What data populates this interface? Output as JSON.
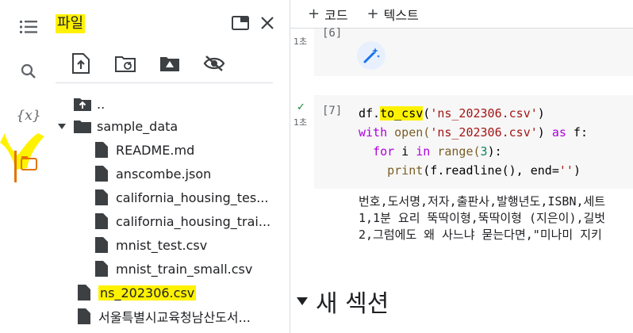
{
  "panel": {
    "title": "파일",
    "highlight_color": "#fff200"
  },
  "tree": [
    {
      "label": "..",
      "type": "folder-up"
    },
    {
      "label": "sample_data",
      "type": "folder"
    },
    {
      "label": "README.md",
      "type": "file"
    },
    {
      "label": "anscombe.json",
      "type": "file"
    },
    {
      "label": "california_housing_tes...",
      "type": "file"
    },
    {
      "label": "california_housing_trai...",
      "type": "file"
    },
    {
      "label": "mnist_test.csv",
      "type": "file"
    },
    {
      "label": "mnist_train_small.csv",
      "type": "file"
    },
    {
      "label": "ns_202306.csv",
      "type": "file"
    },
    {
      "label": "서울특별시교육청남산도서...",
      "type": "file"
    }
  ],
  "notebook": {
    "add_code": "코드",
    "add_text": "텍스트",
    "cell6": {
      "bracket": "[6]",
      "time": "1초"
    },
    "cell7": {
      "bracket": "[7]",
      "time": "1초",
      "line1_a": "df.",
      "line1_b": "to_csv",
      "line1_c": "(",
      "line1_d": "'ns_202306.csv'",
      "line1_e": ")",
      "line2_a": "with",
      "line2_b": " open(",
      "line2_c": "'ns_202306.csv'",
      "line2_d": ") ",
      "line2_e": "as",
      "line2_f": " f:",
      "line3_a": "  for",
      "line3_b": " i ",
      "line3_c": "in",
      "line3_d": " range(",
      "line3_e": "3",
      "line3_f": "):",
      "line4_a": "    print",
      "line4_b": "(f.readline(), end=",
      "line4_c": "''",
      "line4_d": ")"
    },
    "output_lines": [
      "번호,도서명,저자,출판사,발행년도,ISBN,세트",
      "1,1분 요리 뚝딱이형,뚝딱이형 (지은이),길벗",
      "2,그럼에도 왜 사느냐 묻는다면,\"미나미 지키"
    ],
    "section_title": "새 섹션"
  }
}
